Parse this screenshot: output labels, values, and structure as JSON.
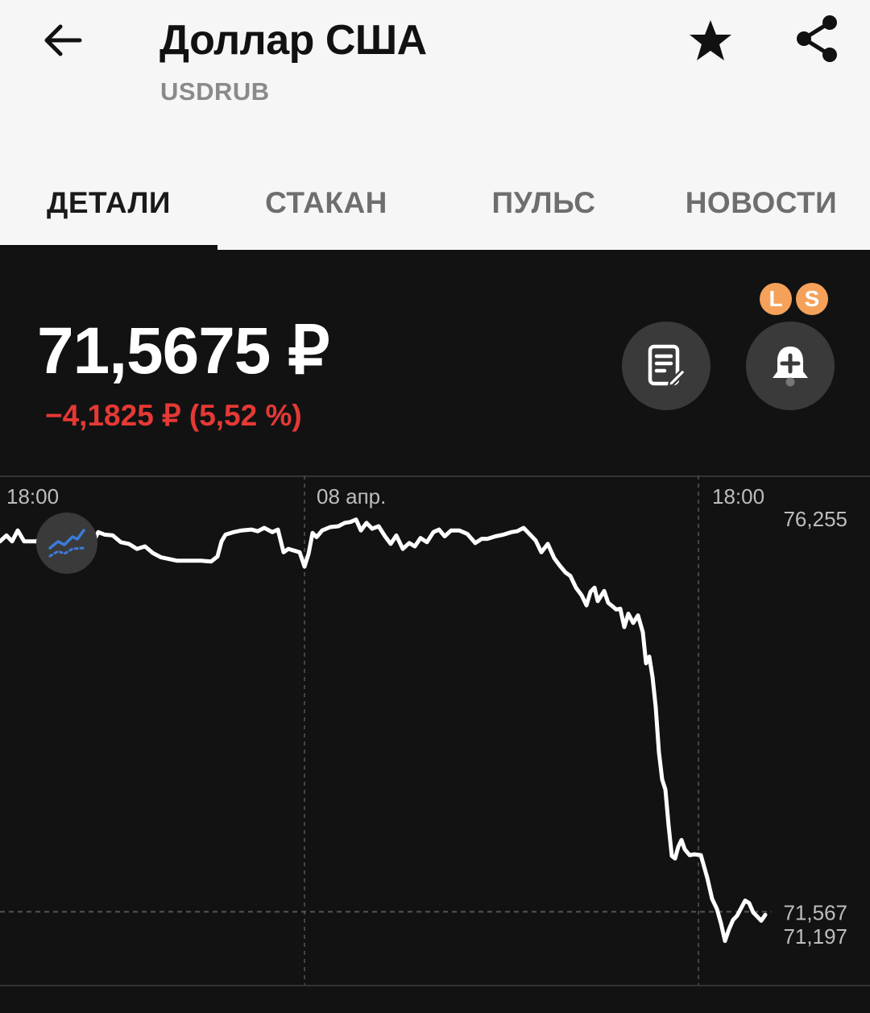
{
  "header": {
    "title": "Доллар США",
    "ticker": "USDRUB",
    "icons": {
      "back": "arrow-left-icon",
      "favorite": "star-icon",
      "share": "share-icon"
    }
  },
  "tabs": [
    {
      "label": "ДЕТАЛИ",
      "active": true
    },
    {
      "label": "СТАКАН",
      "active": false
    },
    {
      "label": "ПУЛЬС",
      "active": false
    },
    {
      "label": "НОВОСТИ",
      "active": false
    }
  ],
  "quote": {
    "price": "71,5675 ₽",
    "change": "−4,1825 ₽ (5,52 %)",
    "change_color": "#e53935"
  },
  "actions": {
    "note_icon": "note-edit-icon",
    "alert_icon": "bell-plus-icon",
    "badges": [
      "L",
      "S"
    ],
    "badge_color": "#f5a15a"
  },
  "chart_data": {
    "type": "line",
    "x_tick_labels": [
      "18:00",
      "08 апр.",
      "18:00"
    ],
    "y_tick_labels": [
      "76,255",
      "71,567",
      "71,197"
    ],
    "current_value_label": "71,567",
    "ylim": [
      71.197,
      76.255
    ],
    "grid": "dashed vertical lines at x tick labels; dashed horizontal line at current value",
    "line_color": "#ffffff",
    "x": [
      0,
      8,
      15,
      22,
      30,
      38,
      45,
      55,
      65,
      80,
      95,
      105,
      115,
      122,
      130,
      140,
      150,
      160,
      170,
      180,
      190,
      200,
      210,
      220,
      235,
      250,
      262,
      270,
      275,
      280,
      290,
      300,
      312,
      320,
      328,
      338,
      345,
      352,
      358,
      365,
      372,
      378,
      383,
      388,
      393,
      400,
      410,
      420,
      428,
      435,
      442,
      448,
      455,
      462,
      470,
      478,
      485,
      492,
      500,
      508,
      515,
      522,
      530,
      538,
      545,
      552,
      560,
      570,
      580,
      590,
      598,
      605,
      615,
      625,
      635,
      642,
      650,
      658,
      665,
      672,
      680,
      688,
      695,
      702,
      708,
      715,
      722,
      728,
      733,
      738,
      742,
      746,
      750,
      755,
      760,
      765,
      770,
      775,
      780,
      786,
      792,
      798,
      802,
      806,
      810,
      814,
      818,
      822,
      826,
      830,
      834,
      838,
      842,
      846,
      850,
      856,
      862,
      870,
      878,
      884,
      890,
      895,
      900,
      905,
      910,
      915,
      920,
      925,
      930,
      935,
      940,
      945,
      950,
      955
    ],
    "values": [
      75.97,
      76.04,
      75.97,
      76.1,
      75.97,
      75.97,
      75.97,
      76.03,
      76.05,
      75.97,
      75.93,
      75.9,
      75.95,
      76.08,
      76.05,
      76.04,
      75.96,
      75.94,
      75.88,
      75.91,
      75.83,
      75.78,
      75.76,
      75.74,
      75.74,
      75.74,
      75.73,
      75.79,
      75.97,
      76.05,
      76.08,
      76.1,
      76.11,
      76.09,
      76.13,
      76.08,
      76.11,
      75.84,
      75.88,
      75.86,
      75.84,
      75.67,
      75.82,
      76.07,
      76.02,
      76.1,
      76.14,
      76.15,
      76.19,
      76.2,
      76.23,
      76.1,
      76.19,
      76.12,
      76.15,
      76.03,
      75.94,
      76.04,
      75.88,
      75.95,
      75.91,
      76.01,
      75.96,
      76.08,
      76.11,
      76.03,
      76.1,
      76.1,
      76.06,
      75.95,
      76.0,
      76.0,
      76.03,
      76.05,
      76.08,
      76.09,
      76.13,
      76.05,
      75.98,
      75.84,
      75.94,
      75.77,
      75.68,
      75.6,
      75.56,
      75.42,
      75.33,
      75.21,
      75.37,
      75.42,
      75.26,
      75.32,
      75.38,
      75.24,
      75.2,
      75.16,
      75.17,
      74.95,
      75.11,
      75.0,
      75.09,
      74.89,
      74.52,
      74.6,
      74.36,
      74.0,
      73.46,
      73.14,
      73.02,
      72.59,
      72.23,
      72.2,
      72.34,
      72.42,
      72.31,
      72.24,
      72.25,
      72.24,
      71.97,
      71.72,
      71.6,
      71.43,
      71.22,
      71.36,
      71.47,
      71.52,
      71.61,
      71.7,
      71.67,
      71.56,
      71.51,
      71.46,
      71.53
    ]
  }
}
